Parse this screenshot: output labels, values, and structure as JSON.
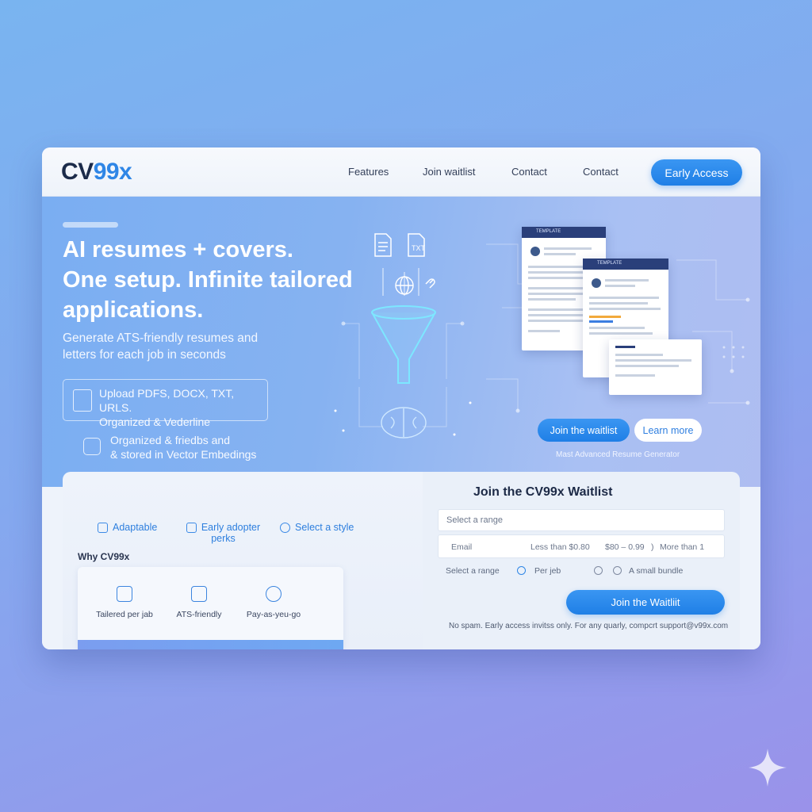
{
  "brand": {
    "logo_a": "CV",
    "logo_b": "99x"
  },
  "nav": {
    "links": [
      "Features",
      "Join waitlist",
      "Contact",
      "Contact"
    ],
    "cta": "Early Access"
  },
  "hero": {
    "title_lines": [
      "AI resumes + covers.",
      "One setup. Infinite tailored",
      "applications."
    ],
    "subtitle": "Generate ATS-friendly resumes and letters for each job in seconds",
    "upload_line1": "Upload PDFS, DOCX, TXT, URLS.",
    "upload_line2": "Organized & Vederline",
    "store_line1": "Organized & friedbs and",
    "store_line2": "& stored in Vector Embedings",
    "file_label": "TXT",
    "doc_header_1": "TEMPLATE",
    "doc_header_2": "TEMPLATE",
    "join_button": "Join the waitlist",
    "learn_button": "Learn more",
    "caption": "Mast Advanced Resume Generator"
  },
  "features": {
    "items": [
      {
        "label": "Adaptable",
        "icon": "puzzle-icon"
      },
      {
        "label": "Early adopter perks",
        "icon": "gift-icon"
      },
      {
        "label": "Select a style",
        "icon": "palette-icon"
      }
    ]
  },
  "why": {
    "title": "Why CV99x",
    "items": [
      {
        "label": "Tailered per jab",
        "icon": "document-edit-icon"
      },
      {
        "label": "ATS-friendly",
        "icon": "ats-icon"
      },
      {
        "label": "Pay-as-yeu-go",
        "icon": "coin-icon"
      }
    ]
  },
  "waitlist": {
    "title": "Join the CV99x Waitlist",
    "select_placeholder": "Select a range",
    "email_label": "Email",
    "range_options": [
      "Less than $0.80",
      "$80 – 0.99",
      ")",
      "More than 1"
    ],
    "option_label": "Select a range",
    "radio_options": [
      "Per jeb",
      "A small bundle"
    ],
    "submit": "Join the Waitliit",
    "footer": "No spam. Early access invitss only. For any quarly, compcrt support@v99x.com"
  },
  "colors": {
    "accent": "#2f86e6",
    "brand_dark": "#1b2b4a"
  }
}
